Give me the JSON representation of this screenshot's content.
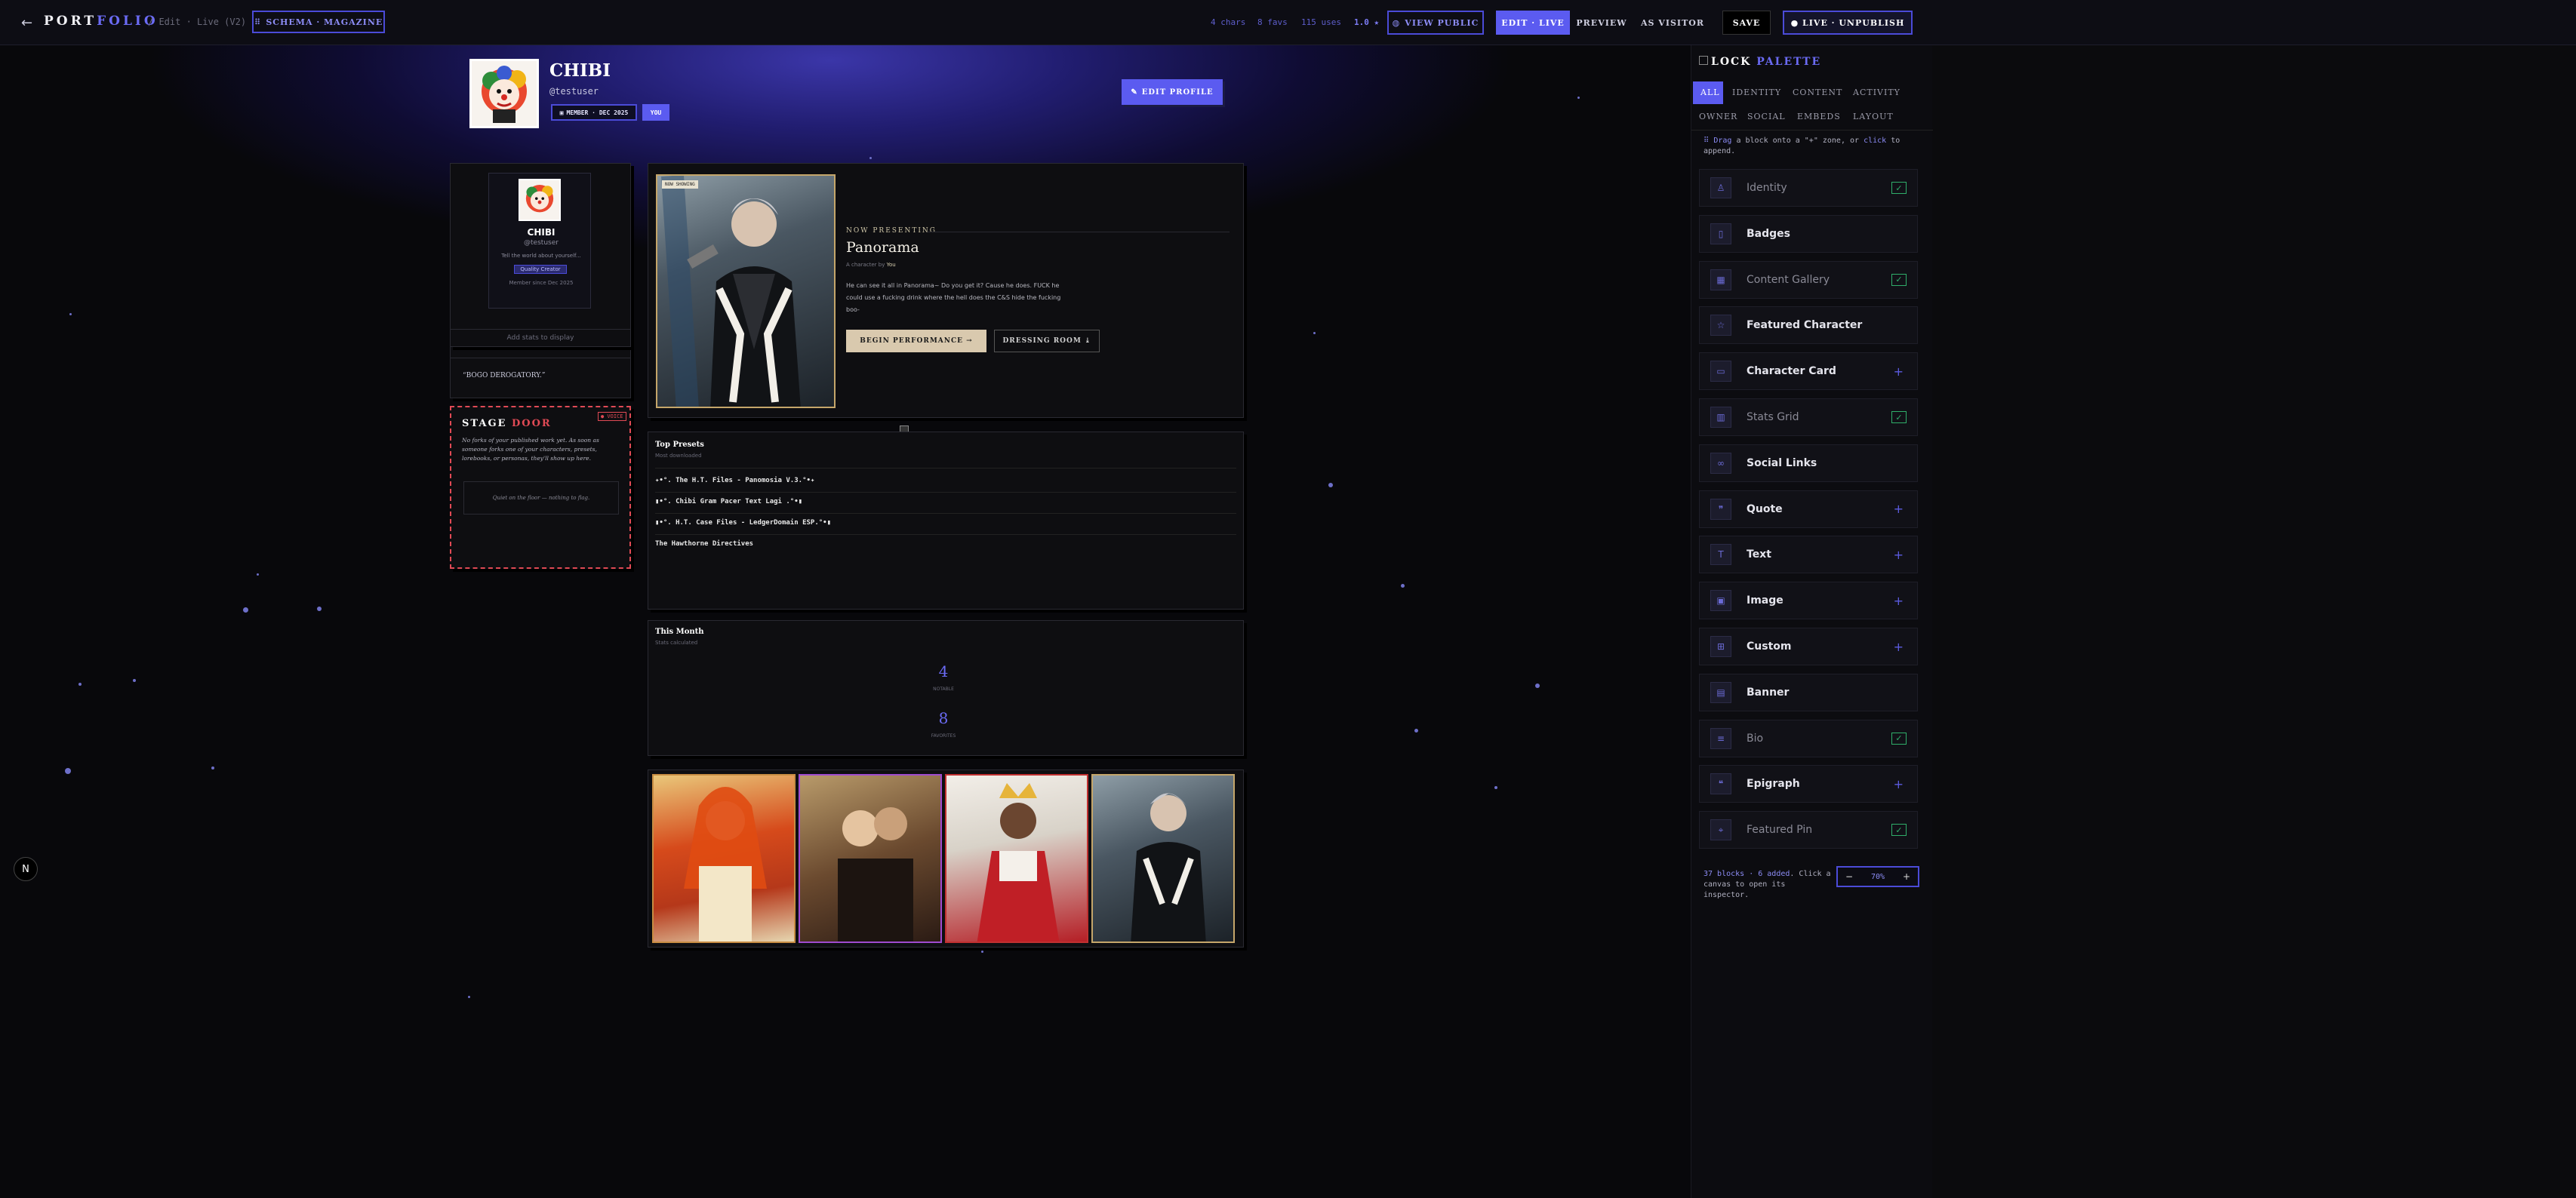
{
  "topbar": {
    "back_arrow": "←",
    "brand_a": "PORT",
    "brand_b": "FOLIO",
    "breadcrumb": "/ Edit · Live (V2)",
    "schema_button": "SCHEMA · MAGAZINE",
    "stats": [
      "4 chars",
      "8 favs",
      "115 uses",
      "1.0 ★"
    ],
    "view_public": "VIEW PUBLIC",
    "modes": [
      "EDIT · LIVE",
      "PREVIEW",
      "AS VISITOR"
    ],
    "save": "SAVE",
    "live_unpublish": "● LIVE · UNPUBLISH"
  },
  "profile": {
    "name": "CHIBI",
    "handle": "@testuser",
    "member_badge": "MEMBER · DEC 2025",
    "extra_badge": "YOU",
    "edit_profile": "EDIT PROFILE"
  },
  "identity_card": {
    "name": "CHIBI",
    "handle": "@testuser",
    "bio": "Tell the world about yourself...",
    "chip": "Quality Creator",
    "member": "Member since Dec 2025"
  },
  "stats_placeholder": "Add stats to display",
  "quote": "“BOGO DEROGATORY.”",
  "stage_door": {
    "title_a": "STAGE",
    "title_b": "DOOR",
    "tag": "● VOICE",
    "body": "No forks of your published work yet. As soon as someone forks one of your characters, presets, lorebooks, or personas, they'll show up here.",
    "empty": "Quiet on the floor — nothing to flag."
  },
  "featured": {
    "poster_tag": "NOW SHOWING",
    "kicker": "NOW PRESENTING",
    "title": "Panorama",
    "byline_prefix": "A character by",
    "byline_author": "You",
    "description": "He can see it all in Panorama~ Do you get it? Cause he does. FUCK he could use a fucking drink where the hell does the C&S hide the fucking boo-",
    "primary_button": "BEGIN PERFORMANCE →",
    "secondary_button": "DRESSING ROOM ⤓"
  },
  "top_presets": {
    "title": "Top Presets",
    "subtitle": "Most downloaded",
    "items": [
      "✦•°. The H.T. Files - Panomosia V.3.°•✦",
      "▮•°. Chibi Gram Pacer Text Lagi .°•▮",
      "▮•°. H.T. Case Files - LedgerDomain ESP.°•▮",
      "The Hawthorne Directives"
    ]
  },
  "this_month": {
    "title": "This Month",
    "subtitle": "Stats calculated",
    "metrics": [
      {
        "value": "4",
        "label": "NOTABLE"
      },
      {
        "value": "8",
        "label": "FAVORITES"
      }
    ]
  },
  "palette": {
    "title_a": "LOCK",
    "title_b": "PALETTE",
    "tabs": [
      "ALL",
      "IDENTITY",
      "CONTENT",
      "ACTIVITY",
      "OWNER",
      "SOCIAL",
      "EMBEDS",
      "LAYOUT"
    ],
    "hint_a": "⠿ Drag",
    "hint_b": "a block onto a \"+\" zone, or",
    "hint_c": "click",
    "hint_d": "to append.",
    "items": [
      {
        "label": "Identity",
        "icon": "person-icon",
        "state": "added"
      },
      {
        "label": "Badges",
        "icon": "badge-icon",
        "state": "none"
      },
      {
        "label": "Content Gallery",
        "icon": "gallery-icon",
        "state": "added"
      },
      {
        "label": "Featured Character",
        "icon": "star-icon",
        "state": "none"
      },
      {
        "label": "Character Card",
        "icon": "card-icon",
        "state": "add"
      },
      {
        "label": "Stats Grid",
        "icon": "chart-icon",
        "state": "added"
      },
      {
        "label": "Social Links",
        "icon": "link-icon",
        "state": "none"
      },
      {
        "label": "Quote",
        "icon": "quote-icon",
        "state": "add"
      },
      {
        "label": "Text",
        "icon": "text-icon",
        "state": "add"
      },
      {
        "label": "Image",
        "icon": "image-icon",
        "state": "add"
      },
      {
        "label": "Custom",
        "icon": "grid-icon",
        "state": "add"
      },
      {
        "label": "Banner",
        "icon": "banner-icon",
        "state": "none"
      },
      {
        "label": "Bio",
        "icon": "bio-icon",
        "state": "added"
      },
      {
        "label": "Epigraph",
        "icon": "epigraph-icon",
        "state": "add"
      },
      {
        "label": "Featured Pin",
        "icon": "pin-icon",
        "state": "added"
      }
    ],
    "footer_a": "37 blocks · 6 added",
    "footer_b": ". Click a",
    "footer_c": "canvas to open its inspector.",
    "zoom_minus": "−",
    "zoom_value": "70%",
    "zoom_plus": "+"
  },
  "fab_icon": "N",
  "icons": {
    "check": "✓",
    "plus": "+"
  },
  "colors": {
    "accent": "#5b5bf0",
    "danger": "#e04a55",
    "check": "#2fae6a"
  }
}
